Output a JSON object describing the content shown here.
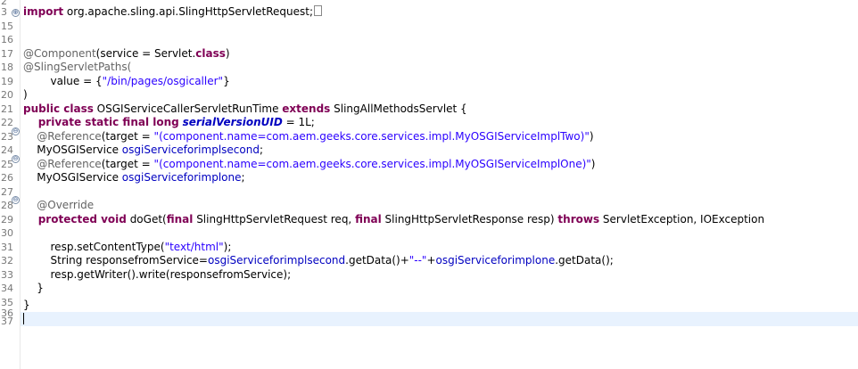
{
  "editor": {
    "line_numbers": [
      "2",
      "3",
      "15",
      "16",
      "17",
      "18",
      "19",
      "20",
      "21",
      "22",
      "23",
      "24",
      "25",
      "26",
      "27",
      "28",
      "29",
      "30",
      "31",
      "32",
      "33",
      "34",
      "35",
      "36",
      "37"
    ],
    "fold_markers": {
      "line3": "⊕",
      "line23": "⊖",
      "line25": "⊖",
      "line28": "⊖"
    },
    "code": {
      "l3_kw": "import",
      "l3_rest": " org.apache.sling.api.SlingHttpServletRequest;",
      "l17_ann": "@Component",
      "l17_a": "(service = Servlet.",
      "l17_kw": "class",
      "l17_b": ")",
      "l18": "@SlingServletPaths(",
      "l19_a": "        value = {",
      "l19_str": "\"/bin/pages/osgicaller\"",
      "l19_b": "}",
      "l20": ")",
      "l21_kw1": "public class",
      "l21_a": " OSGIServiceCallerServletRunTime ",
      "l21_kw2": "extends",
      "l21_b": " SlingAllMethodsServlet {",
      "l22_kw": "    private static final long",
      "l22_sp": " ",
      "l22_fd": "serialVersionUID",
      "l22_b": " = 1L;",
      "l23_ann": "    @Reference",
      "l23_a": "(target = ",
      "l23_str": "\"(component.name=com.aem.geeks.core.services.impl.MyOSGIServiceImplTwo)\"",
      "l23_b": ")",
      "l24_a": "    MyOSGIService ",
      "l24_fd": "osgiServiceforimplsecond",
      "l24_b": ";",
      "l25_ann": "    @Reference",
      "l25_a": "(target = ",
      "l25_str": "\"(component.name=com.aem.geeks.core.services.impl.MyOSGIServiceImplOne)\"",
      "l25_b": ")",
      "l26_a": "    MyOSGIService ",
      "l26_fd": "osgiServiceforimplone",
      "l26_b": ";",
      "l28_ann": "    @Override",
      "l29_kw1": "    protected void",
      "l29_a": " doGet(",
      "l29_kw2": "final",
      "l29_b": " SlingHttpServletRequest req, ",
      "l29_kw3": "final",
      "l29_c": " SlingHttpServletResponse resp) ",
      "l29_kw4": "throws",
      "l29_d": " ServletException, IOException",
      "l31_a": "        resp.setContentType(",
      "l31_str": "\"text/html\"",
      "l31_b": ");",
      "l32_a": "        String responsefromService=",
      "l32_fd1": "osgiServiceforimplsecond",
      "l32_b": ".getData()+",
      "l32_str": "\"--\"",
      "l32_c": "+",
      "l32_fd2": "osgiServiceforimplone",
      "l32_d": ".getData();",
      "l33": "        resp.getWriter().write(responsefromService);",
      "l34": "    }",
      "l36": "}"
    }
  }
}
